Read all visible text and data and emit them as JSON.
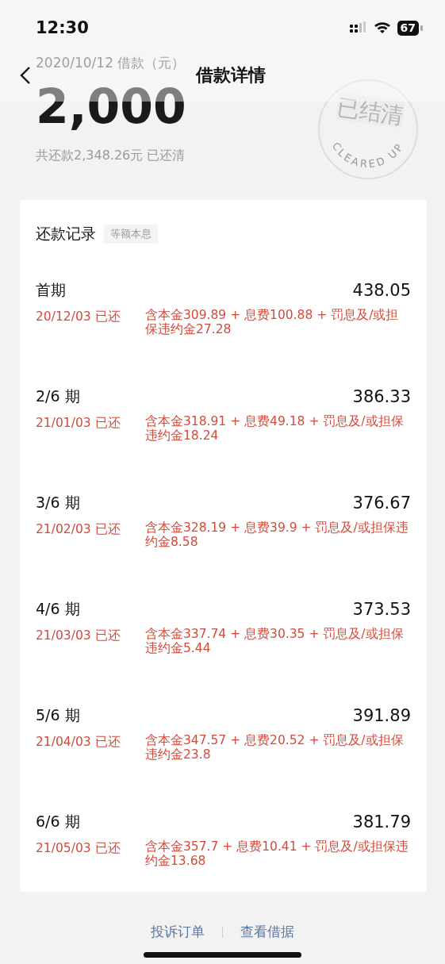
{
  "status_bar": {
    "time": "12:30",
    "battery": "67"
  },
  "nav": {
    "title": "借款详情"
  },
  "loan": {
    "date_label": "2020/10/12 借款（元）",
    "amount": "2,000",
    "summary": "共还款2,348.26元 已还清",
    "stamp": {
      "text": "已结清",
      "arc_text": "CLEARED UP"
    }
  },
  "repayments": {
    "title": "还款记录",
    "tag": "等额本息",
    "items": [
      {
        "period": "首期",
        "amount": "438.05",
        "date_status": "20/12/03 已还",
        "breakdown": "含本金309.89 + 息费100.88 + 罚息及/或担保违约金27.28"
      },
      {
        "period": "2/6 期",
        "amount": "386.33",
        "date_status": "21/01/03 已还",
        "breakdown": "含本金318.91 + 息费49.18 + 罚息及/或担保违约金18.24"
      },
      {
        "period": "3/6 期",
        "amount": "376.67",
        "date_status": "21/02/03 已还",
        "breakdown": "含本金328.19 + 息费39.9 + 罚息及/或担保违约金8.58"
      },
      {
        "period": "4/6 期",
        "amount": "373.53",
        "date_status": "21/03/03 已还",
        "breakdown": "含本金337.74 + 息费30.35 + 罚息及/或担保违约金5.44"
      },
      {
        "period": "5/6 期",
        "amount": "391.89",
        "date_status": "21/04/03 已还",
        "breakdown": "含本金347.57 + 息费20.52 + 罚息及/或担保违约金23.8"
      },
      {
        "period": "6/6 期",
        "amount": "381.79",
        "date_status": "21/05/03 已还",
        "breakdown": "含本金357.7 + 息费10.41 + 罚息及/或担保违约金13.68"
      }
    ]
  },
  "footer": {
    "links": [
      "投诉订单",
      "查看借据"
    ]
  }
}
